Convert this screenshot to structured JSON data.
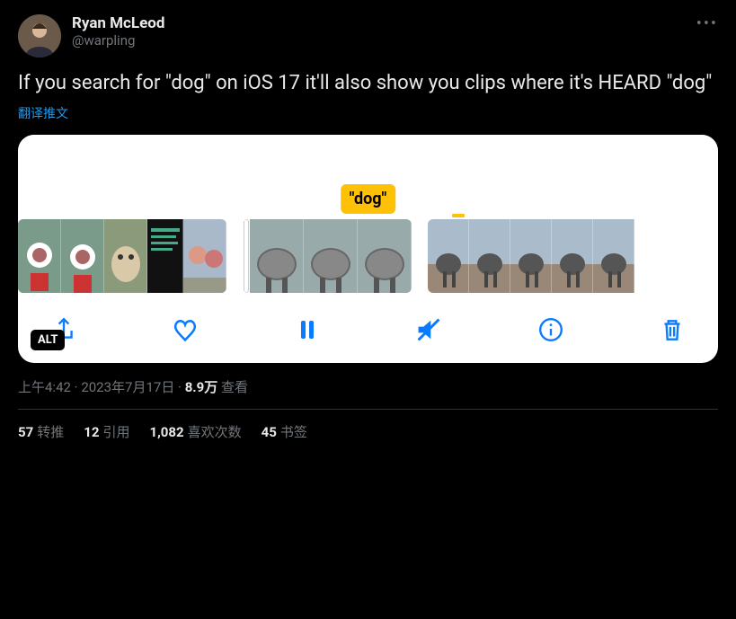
{
  "user": {
    "display_name": "Ryan McLeod",
    "handle": "@warpling"
  },
  "tweet_text": "If you search for \"dog\" on iOS 17 it'll also show you clips where it's HEARD \"dog\"",
  "translate_label": "翻译推文",
  "media": {
    "caption_badge": "\"dog\"",
    "alt_badge": "ALT",
    "controls": {
      "share": "share",
      "like": "like",
      "pause": "pause",
      "mute": "mute",
      "info": "info",
      "delete": "delete"
    }
  },
  "meta": {
    "time": "上午4:42",
    "dot1": " · ",
    "date": "2023年7月17日",
    "dot2": " · ",
    "views_number": "8.9万",
    "views_label": " 查看"
  },
  "stats": {
    "retweets_num": "57",
    "retweets_label": "转推",
    "quotes_num": "12",
    "quotes_label": "引用",
    "likes_num": "1,082",
    "likes_label": "喜欢次数",
    "bookmarks_num": "45",
    "bookmarks_label": "书签"
  }
}
